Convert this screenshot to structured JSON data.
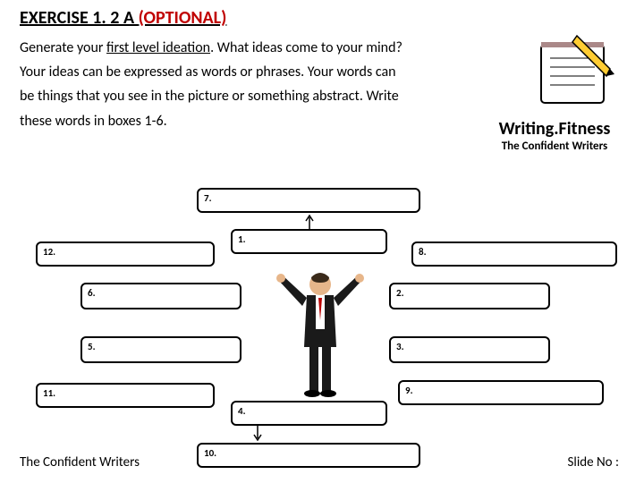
{
  "title": {
    "prefix": "EXERCISE 1. 2 A ",
    "optional": "(OPTIONAL)"
  },
  "intro": {
    "p1a": "Generate your ",
    "p1u": "first level ideation",
    "p1b": ". What ideas come to your mind?  Your ideas can be expressed as words or phrases.  Your words can be things that you see in the picture or something abstract. Write these words in boxes 1-6."
  },
  "brand": {
    "title": "Writing.Fitness",
    "sub": "The Confident Writers"
  },
  "boxes": {
    "b1": "1.",
    "b2": "2.",
    "b3": "3.",
    "b4": "4.",
    "b5": "5.",
    "b6": "6.",
    "b7": "7.",
    "b8": "8.",
    "b9": "9.",
    "b10": "10.",
    "b11": "11.",
    "b12": "12."
  },
  "footer": {
    "left": "The Confident Writers",
    "right": "Slide No :"
  }
}
